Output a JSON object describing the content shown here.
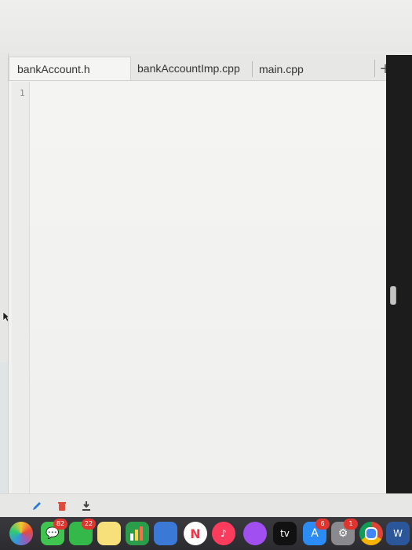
{
  "tabs": [
    {
      "label": "bankAccount.h",
      "active": true
    },
    {
      "label": "bankAccountImp.cpp",
      "active": false
    },
    {
      "label": "main.cpp",
      "active": false
    }
  ],
  "add_tab_symbol": "+",
  "close_symbol": "×",
  "editor": {
    "line_numbers": [
      "1"
    ]
  },
  "toolbar": {
    "edit_icon": "pencil-icon",
    "delete_icon": "trash-icon",
    "download_icon": "download-icon"
  },
  "dock": {
    "apps": [
      {
        "name": "photos-icon",
        "badge": ""
      },
      {
        "name": "messages-icon",
        "badge": "82"
      },
      {
        "name": "facetime-icon",
        "badge": "22"
      },
      {
        "name": "notes-icon",
        "badge": ""
      },
      {
        "name": "numbers-icon",
        "badge": ""
      },
      {
        "name": "keynote-icon",
        "badge": ""
      },
      {
        "name": "news-icon",
        "badge": ""
      },
      {
        "name": "music-icon",
        "badge": ""
      },
      {
        "name": "podcasts-icon",
        "badge": ""
      },
      {
        "name": "tv-icon",
        "badge": "",
        "label": "tv"
      },
      {
        "name": "app-store-icon",
        "badge": "6"
      },
      {
        "name": "system-preferences-icon",
        "badge": "1"
      },
      {
        "name": "chrome-icon",
        "badge": ""
      },
      {
        "name": "word-icon",
        "badge": "",
        "label": "W"
      }
    ]
  },
  "colors": {
    "dock_bg": "#2b2b30",
    "editor_bg": "#f2f2f0",
    "tab_active_bg": "#f5f5f3",
    "badge_red": "#e0352f",
    "delete_red": "#e04a3a",
    "edit_blue": "#2a7ad8"
  }
}
